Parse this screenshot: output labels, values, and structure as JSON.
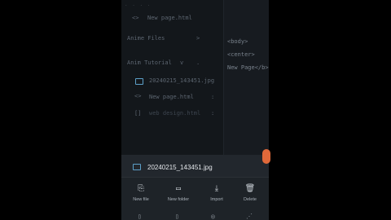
{
  "sidebar": {
    "items": [
      {
        "icon": "code-icon",
        "label": "New page.html"
      },
      {
        "label": "Anime Files"
      },
      {
        "label": "Anim Tutorial"
      },
      {
        "icon": "image-icon",
        "label": "20240215_143451.jpg"
      },
      {
        "icon": "code-icon",
        "label": "New page.html"
      },
      {
        "icon": "brackets-icon",
        "label": "web design.html"
      }
    ]
  },
  "editor": {
    "lines": [
      "<body>",
      "<center>",
      "New Page</b>"
    ]
  },
  "sheet": {
    "file_name": "20240215_143451.jpg",
    "actions": [
      {
        "icon": "new-file-icon",
        "label": "New file"
      },
      {
        "icon": "new-folder-icon",
        "label": "New folder"
      },
      {
        "icon": "import-icon",
        "label": "Import"
      },
      {
        "icon": "delete-icon",
        "label": "Delete"
      }
    ]
  },
  "colors": {
    "accent": "#e0693a",
    "background": "#161a1f",
    "sheet": "#1e2328"
  }
}
